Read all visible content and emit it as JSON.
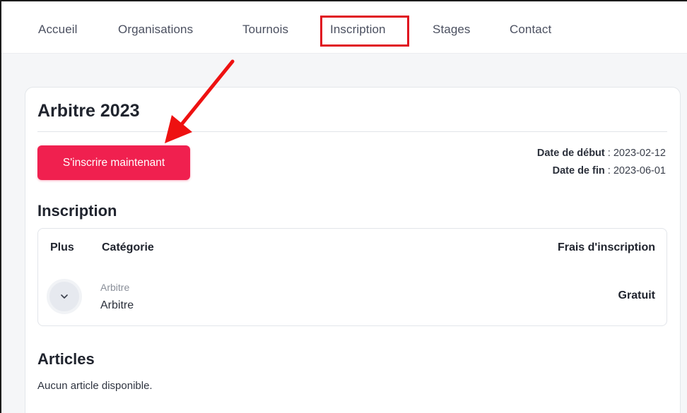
{
  "nav": {
    "items": [
      {
        "label": "Accueil"
      },
      {
        "label": "Organisations"
      },
      {
        "label": "Tournois"
      },
      {
        "label": "Inscription"
      },
      {
        "label": "Stages"
      },
      {
        "label": "Contact"
      }
    ],
    "active": "Inscription"
  },
  "event": {
    "title": "Arbitre 2023",
    "register_button": "S'inscrire maintenant",
    "start_label": "Date de début",
    "start_value": " : 2023-02-12",
    "end_label": "Date de fin",
    "end_value": " : 2023-06-01"
  },
  "registration": {
    "section_title": "Inscription",
    "columns": {
      "more": "Plus",
      "category": "Catégorie",
      "fee": "Frais d'inscription"
    },
    "rows": [
      {
        "category_sub": "Arbitre",
        "category": "Arbitre",
        "fee": "Gratuit"
      }
    ]
  },
  "articles": {
    "section_title": "Articles",
    "empty_text": "Aucun article disponible."
  },
  "colors": {
    "accent": "#f0204f",
    "highlight": "#e0131f"
  },
  "icons": {
    "expand": "chevron-down-icon",
    "annotation": "arrow-icon"
  }
}
